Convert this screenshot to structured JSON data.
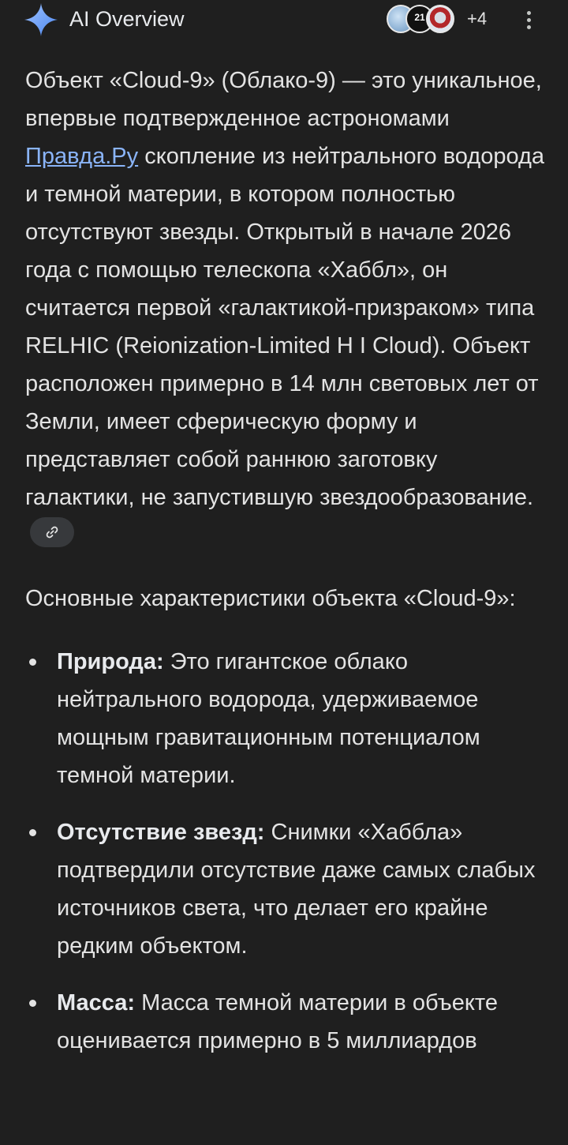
{
  "header": {
    "title": "AI Overview",
    "sources_more": "+4",
    "avatar_2_text": "21"
  },
  "colors": {
    "background": "#1f1f1f",
    "text": "#e3e3e3",
    "link": "#8ab4f8",
    "chip": "#37393c"
  },
  "overview": {
    "p1_before": "Объект «Cloud-9» (Облако-9) — это уникальное, впервые подтвержденное астрономами ",
    "p1_link": "Правда.Ру",
    "p1_after": " скопление из нейтрального водорода и темной материи, в котором полностью отсутствуют звезды. Открытый в начале 2026 года с помощью телескопа «Хаббл», он считается первой «галактикой-призраком» типа RELHIC (Reionization-Limited H I Cloud). Объект расположен примерно в 14 млн световых лет от Земли, имеет сферическую форму и представляет собой раннюю заготовку галактики, не запустившую звездообразование.",
    "link_chip_icon": "link-icon",
    "intro": "Основные характеристики объекта «Cloud-9»:",
    "bullets": [
      {
        "term": "Природа:",
        "text": " Это гигантское облако нейтрального водорода, удерживаемое мощным гравитационным потенциалом темной материи."
      },
      {
        "term": "Отсутствие звезд:",
        "text": " Снимки «Хаббла» подтвердили отсутствие даже самых слабых источников света, что делает его крайне редким объектом."
      },
      {
        "term": "Масса:",
        "text": " Масса темной материи в объекте оценивается примерно в 5 миллиардов"
      }
    ]
  }
}
